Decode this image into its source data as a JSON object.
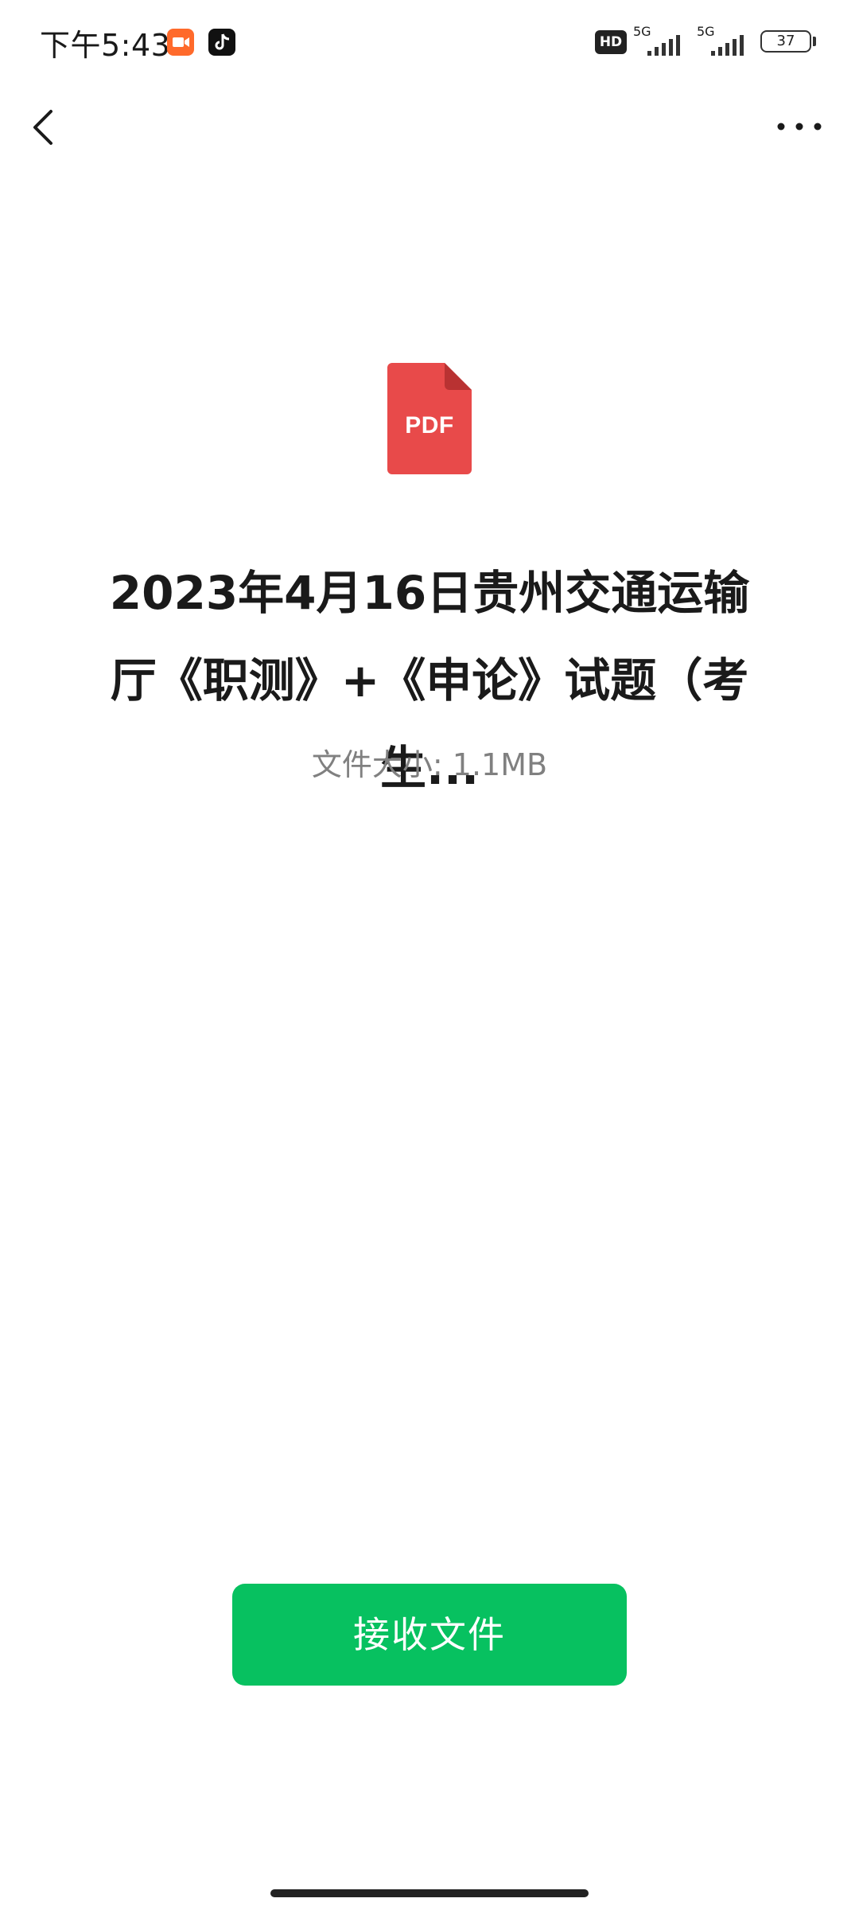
{
  "status_bar": {
    "time": "下午5:43",
    "hd_label": "HD",
    "sim1_label": "5G",
    "sim2_label": "5G",
    "battery_level": "37",
    "icons": [
      "video-app-icon",
      "tiktok-icon",
      "hd-voice-icon",
      "signal-icon",
      "signal-icon",
      "battery-icon"
    ]
  },
  "nav": {
    "back_icon": "chevron-left-icon",
    "more_icon": "more-horizontal-icon"
  },
  "file": {
    "icon_label": "PDF",
    "icon_color": "#e84a4a",
    "title": "2023年4月16日贵州交通运输厅《职测》+《申论》试题（考生...",
    "size_label": "文件大小:",
    "size_value": "1.1MB"
  },
  "actions": {
    "accept_label": "接收文件",
    "accept_color": "#07c160"
  }
}
